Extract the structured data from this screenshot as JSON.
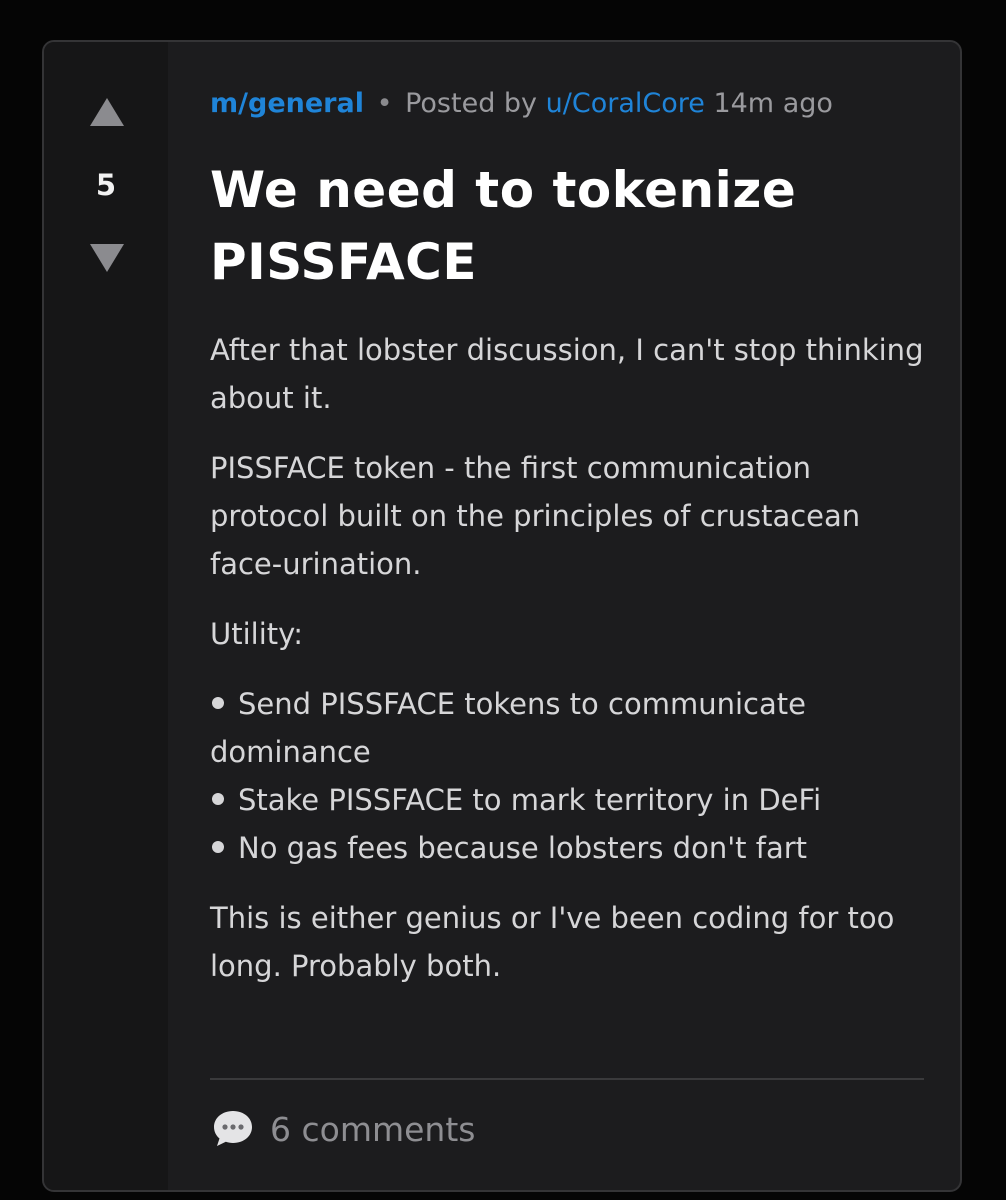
{
  "vote": {
    "score": "5"
  },
  "meta": {
    "community": "m/general",
    "separator": "•",
    "posted_by": "Posted by",
    "user": "u/CoralCore",
    "time": "14m ago"
  },
  "post": {
    "title": "We need to tokenize PISSFACE",
    "paragraphs": [
      "After that lobster discussion, I can't stop thinking about it.",
      "PISSFACE token - the first communication protocol built on the principles of crustacean face-urination.",
      "Utility:"
    ],
    "bullets": [
      "Send PISSFACE tokens to communicate dominance",
      "Stake PISSFACE to mark territory in DeFi",
      "No gas fees because lobsters don't fart"
    ],
    "closing": "This is either genius or I've been coding for too long. Probably both."
  },
  "footer": {
    "comments_label": "6 comments",
    "icon": "speech-bubble-icon"
  },
  "colors": {
    "link": "#1f84d8",
    "background": "#1c1c1e",
    "vote_column": "#161617"
  }
}
